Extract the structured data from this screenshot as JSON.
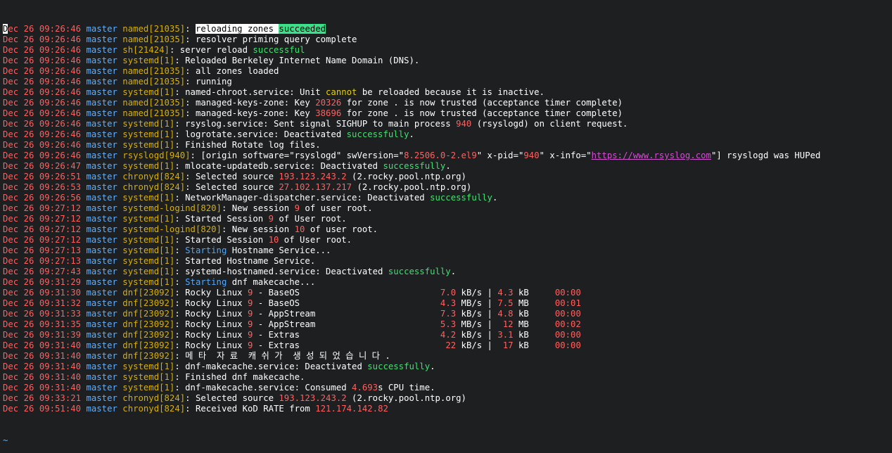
{
  "terminal": {
    "lines": [
      [
        [
          "date",
          "Dec 26 09:26:46"
        ],
        [
          "host",
          " master"
        ],
        [
          "proc",
          " named[21035]"
        ],
        [
          "msg",
          ": "
        ],
        [
          "sel",
          "reloading zones "
        ],
        [
          "selok",
          "succeeded"
        ]
      ],
      [
        [
          "date",
          "Dec 26 09:26:46"
        ],
        [
          "host",
          " master"
        ],
        [
          "proc",
          " named[21035]"
        ],
        [
          "msg",
          ": resolver priming query complete"
        ]
      ],
      [
        [
          "date",
          "Dec 26 09:26:46"
        ],
        [
          "host",
          " master"
        ],
        [
          "proc",
          " sh[21424]"
        ],
        [
          "msg",
          ": server reload "
        ],
        [
          "ok",
          "successful"
        ]
      ],
      [
        [
          "date",
          "Dec 26 09:26:46"
        ],
        [
          "host",
          " master"
        ],
        [
          "proc",
          " systemd[1]"
        ],
        [
          "msg",
          ": Reloaded Berkeley Internet Name Domain (DNS)."
        ]
      ],
      [
        [
          "date",
          "Dec 26 09:26:46"
        ],
        [
          "host",
          " master"
        ],
        [
          "proc",
          " named[21035]"
        ],
        [
          "msg",
          ": all zones loaded"
        ]
      ],
      [
        [
          "date",
          "Dec 26 09:26:46"
        ],
        [
          "host",
          " master"
        ],
        [
          "proc",
          " named[21035]"
        ],
        [
          "msg",
          ": running"
        ]
      ],
      [
        [
          "date",
          "Dec 26 09:26:46"
        ],
        [
          "host",
          " master"
        ],
        [
          "proc",
          " systemd[1]"
        ],
        [
          "msg",
          ": named-chroot.service: Unit "
        ],
        [
          "warn",
          "cannot"
        ],
        [
          "msg",
          " be reloaded because it is inactive."
        ]
      ],
      [
        [
          "date",
          "Dec 26 09:26:46"
        ],
        [
          "host",
          " master"
        ],
        [
          "proc",
          " named[21035]"
        ],
        [
          "msg",
          ": managed-keys-zone: Key "
        ],
        [
          "num",
          "20326"
        ],
        [
          "msg",
          " for zone . is now trusted (acceptance timer complete)"
        ]
      ],
      [
        [
          "date",
          "Dec 26 09:26:46"
        ],
        [
          "host",
          " master"
        ],
        [
          "proc",
          " named[21035]"
        ],
        [
          "msg",
          ": managed-keys-zone: Key "
        ],
        [
          "num",
          "38696"
        ],
        [
          "msg",
          " for zone . is now trusted (acceptance timer complete)"
        ]
      ],
      [
        [
          "date",
          "Dec 26 09:26:46"
        ],
        [
          "host",
          " master"
        ],
        [
          "proc",
          " systemd[1]"
        ],
        [
          "msg",
          ": rsyslog.service: Sent signal SIGHUP to main process "
        ],
        [
          "num",
          "940"
        ],
        [
          "msg",
          " (rsyslogd) on client request."
        ]
      ],
      [
        [
          "date",
          "Dec 26 09:26:46"
        ],
        [
          "host",
          " master"
        ],
        [
          "proc",
          " systemd[1]"
        ],
        [
          "msg",
          ": logrotate.service: Deactivated "
        ],
        [
          "ok",
          "successfully"
        ],
        [
          "msg",
          "."
        ]
      ],
      [
        [
          "date",
          "Dec 26 09:26:46"
        ],
        [
          "host",
          " master"
        ],
        [
          "proc",
          " systemd[1]"
        ],
        [
          "msg",
          ": Finished Rotate log files."
        ]
      ],
      [
        [
          "date",
          "Dec 26 09:26:46"
        ],
        [
          "host",
          " master"
        ],
        [
          "proc",
          " rsyslogd[940]"
        ],
        [
          "msg",
          ": [origin software=\"rsyslogd\" swVersion=\""
        ],
        [
          "num",
          "8.2506.0-2.el9"
        ],
        [
          "msg",
          "\" x-pid=\""
        ],
        [
          "num",
          "940"
        ],
        [
          "msg",
          "\" x-info=\""
        ],
        [
          "link",
          "https://www.rsyslog.com"
        ],
        [
          "msg",
          "\"] rsyslogd was HUPed"
        ]
      ],
      [
        [
          "date",
          "Dec 26 09:26:47"
        ],
        [
          "host",
          " master"
        ],
        [
          "proc",
          " systemd[1]"
        ],
        [
          "msg",
          ": mlocate-updatedb.service: Deactivated "
        ],
        [
          "ok",
          "successfully"
        ],
        [
          "msg",
          "."
        ]
      ],
      [
        [
          "date",
          "Dec 26 09:26:51"
        ],
        [
          "host",
          " master"
        ],
        [
          "proc",
          " chronyd[824]"
        ],
        [
          "msg",
          ": Selected source "
        ],
        [
          "num",
          "193.123.243.2"
        ],
        [
          "msg",
          " (2.rocky.pool.ntp.org)"
        ]
      ],
      [
        [
          "date",
          "Dec 26 09:26:53"
        ],
        [
          "host",
          " master"
        ],
        [
          "proc",
          " chronyd[824]"
        ],
        [
          "msg",
          ": Selected source "
        ],
        [
          "num",
          "27.102.137.217"
        ],
        [
          "msg",
          " (2.rocky.pool.ntp.org)"
        ]
      ],
      [
        [
          "date",
          "Dec 26 09:26:56"
        ],
        [
          "host",
          " master"
        ],
        [
          "proc",
          " systemd[1]"
        ],
        [
          "msg",
          ": NetworkManager-dispatcher.service: Deactivated "
        ],
        [
          "ok",
          "successfully"
        ],
        [
          "msg",
          "."
        ]
      ],
      [
        [
          "date",
          "Dec 26 09:27:12"
        ],
        [
          "host",
          " master"
        ],
        [
          "proc",
          " systemd-logind[820]"
        ],
        [
          "msg",
          ": New session "
        ],
        [
          "num",
          "9"
        ],
        [
          "msg",
          " of user root."
        ]
      ],
      [
        [
          "date",
          "Dec 26 09:27:12"
        ],
        [
          "host",
          " master"
        ],
        [
          "proc",
          " systemd[1]"
        ],
        [
          "msg",
          ": Started Session "
        ],
        [
          "num",
          "9"
        ],
        [
          "msg",
          " of User root."
        ]
      ],
      [
        [
          "date",
          "Dec 26 09:27:12"
        ],
        [
          "host",
          " master"
        ],
        [
          "proc",
          " systemd-logind[820]"
        ],
        [
          "msg",
          ": New session "
        ],
        [
          "num",
          "10"
        ],
        [
          "msg",
          " of user root."
        ]
      ],
      [
        [
          "date",
          "Dec 26 09:27:12"
        ],
        [
          "host",
          " master"
        ],
        [
          "proc",
          " systemd[1]"
        ],
        [
          "msg",
          ": Started Session "
        ],
        [
          "num",
          "10"
        ],
        [
          "msg",
          " of User root."
        ]
      ],
      [
        [
          "date",
          "Dec 26 09:27:13"
        ],
        [
          "host",
          " master"
        ],
        [
          "proc",
          " systemd[1]"
        ],
        [
          "msg",
          ": "
        ],
        [
          "info",
          "Starting"
        ],
        [
          "msg",
          " Hostname Service..."
        ]
      ],
      [
        [
          "date",
          "Dec 26 09:27:13"
        ],
        [
          "host",
          " master"
        ],
        [
          "proc",
          " systemd[1]"
        ],
        [
          "msg",
          ": Started Hostname Service."
        ]
      ],
      [
        [
          "date",
          "Dec 26 09:27:43"
        ],
        [
          "host",
          " master"
        ],
        [
          "proc",
          " systemd[1]"
        ],
        [
          "msg",
          ": systemd-hostnamed.service: Deactivated "
        ],
        [
          "ok",
          "successfully"
        ],
        [
          "msg",
          "."
        ]
      ],
      [
        [
          "date",
          "Dec 26 09:31:29"
        ],
        [
          "host",
          " master"
        ],
        [
          "proc",
          " systemd[1]"
        ],
        [
          "msg",
          ": "
        ],
        [
          "info",
          "Starting"
        ],
        [
          "msg",
          " dnf makecache..."
        ]
      ],
      [
        [
          "date",
          "Dec 26 09:31:30"
        ],
        [
          "host",
          " master"
        ],
        [
          "proc",
          " dnf[23092]"
        ],
        [
          "msg",
          ": Rocky Linux "
        ],
        [
          "num",
          "9"
        ],
        [
          "msg",
          " - BaseOS                           "
        ],
        [
          "num",
          "7.0"
        ],
        [
          "msg",
          " kB/s | "
        ],
        [
          "num",
          "4.3"
        ],
        [
          "msg",
          " kB     "
        ],
        [
          "num",
          "00:00"
        ]
      ],
      [
        [
          "date",
          "Dec 26 09:31:32"
        ],
        [
          "host",
          " master"
        ],
        [
          "proc",
          " dnf[23092]"
        ],
        [
          "msg",
          ": Rocky Linux "
        ],
        [
          "num",
          "9"
        ],
        [
          "msg",
          " - BaseOS                           "
        ],
        [
          "num",
          "4.3"
        ],
        [
          "msg",
          " MB/s | "
        ],
        [
          "num",
          "7.5"
        ],
        [
          "msg",
          " MB     "
        ],
        [
          "num",
          "00:01"
        ]
      ],
      [
        [
          "date",
          "Dec 26 09:31:33"
        ],
        [
          "host",
          " master"
        ],
        [
          "proc",
          " dnf[23092]"
        ],
        [
          "msg",
          ": Rocky Linux "
        ],
        [
          "num",
          "9"
        ],
        [
          "msg",
          " - AppStream                        "
        ],
        [
          "num",
          "7.3"
        ],
        [
          "msg",
          " kB/s | "
        ],
        [
          "num",
          "4.8"
        ],
        [
          "msg",
          " kB     "
        ],
        [
          "num",
          "00:00"
        ]
      ],
      [
        [
          "date",
          "Dec 26 09:31:35"
        ],
        [
          "host",
          " master"
        ],
        [
          "proc",
          " dnf[23092]"
        ],
        [
          "msg",
          ": Rocky Linux "
        ],
        [
          "num",
          "9"
        ],
        [
          "msg",
          " - AppStream                        "
        ],
        [
          "num",
          "5.3"
        ],
        [
          "msg",
          " MB/s |  "
        ],
        [
          "num",
          "12"
        ],
        [
          "msg",
          " MB     "
        ],
        [
          "num",
          "00:02"
        ]
      ],
      [
        [
          "date",
          "Dec 26 09:31:39"
        ],
        [
          "host",
          " master"
        ],
        [
          "proc",
          " dnf[23092]"
        ],
        [
          "msg",
          ": Rocky Linux "
        ],
        [
          "num",
          "9"
        ],
        [
          "msg",
          " - Extras                           "
        ],
        [
          "num",
          "4.2"
        ],
        [
          "msg",
          " kB/s | "
        ],
        [
          "num",
          "3.1"
        ],
        [
          "msg",
          " kB     "
        ],
        [
          "num",
          "00:00"
        ]
      ],
      [
        [
          "date",
          "Dec 26 09:31:40"
        ],
        [
          "host",
          " master"
        ],
        [
          "proc",
          " dnf[23092]"
        ],
        [
          "msg",
          ": Rocky Linux "
        ],
        [
          "num",
          "9"
        ],
        [
          "msg",
          " - Extras                            "
        ],
        [
          "num",
          "22"
        ],
        [
          "msg",
          " kB/s |  "
        ],
        [
          "num",
          "17"
        ],
        [
          "msg",
          " kB     "
        ],
        [
          "num",
          "00:00"
        ]
      ],
      [
        [
          "date",
          "Dec 26 09:31:40"
        ],
        [
          "host",
          " master"
        ],
        [
          "proc",
          " dnf[23092]"
        ],
        [
          "msg",
          ": 메 타  자 료  캐 쉬 가  생 성 되 었 습 니 다 ."
        ]
      ],
      [
        [
          "date",
          "Dec 26 09:31:40"
        ],
        [
          "host",
          " master"
        ],
        [
          "proc",
          " systemd[1]"
        ],
        [
          "msg",
          ": dnf-makecache.service: Deactivated "
        ],
        [
          "ok",
          "successfully"
        ],
        [
          "msg",
          "."
        ]
      ],
      [
        [
          "date",
          "Dec 26 09:31:40"
        ],
        [
          "host",
          " master"
        ],
        [
          "proc",
          " systemd[1]"
        ],
        [
          "msg",
          ": Finished dnf makecache."
        ]
      ],
      [
        [
          "date",
          "Dec 26 09:31:40"
        ],
        [
          "host",
          " master"
        ],
        [
          "proc",
          " systemd[1]"
        ],
        [
          "msg",
          ": dnf-makecache.service: Consumed "
        ],
        [
          "num",
          "4.693"
        ],
        [
          "msg",
          "s CPU time."
        ]
      ],
      [
        [
          "date",
          "Dec 26 09:33:21"
        ],
        [
          "host",
          " master"
        ],
        [
          "proc",
          " chronyd[824]"
        ],
        [
          "msg",
          ": Selected source "
        ],
        [
          "num",
          "193.123.243.2"
        ],
        [
          "msg",
          " (2.rocky.pool.ntp.org)"
        ]
      ],
      [
        [
          "date",
          "Dec 26 09:51:40"
        ],
        [
          "host",
          " master"
        ],
        [
          "proc",
          " chronyd[824]"
        ],
        [
          "msg",
          ": Received KoD RATE from "
        ],
        [
          "num",
          "121.174.142.82"
        ]
      ]
    ],
    "end_marker": "~",
    "colors": {
      "background": "#1d1f21",
      "date": "#ff5f5f",
      "host": "#5fafff",
      "process": "#d7af00",
      "number": "#ff6060",
      "success": "#40e070",
      "warning": "#e6d000",
      "info": "#4fa8ff",
      "link": "#d050d0"
    }
  }
}
